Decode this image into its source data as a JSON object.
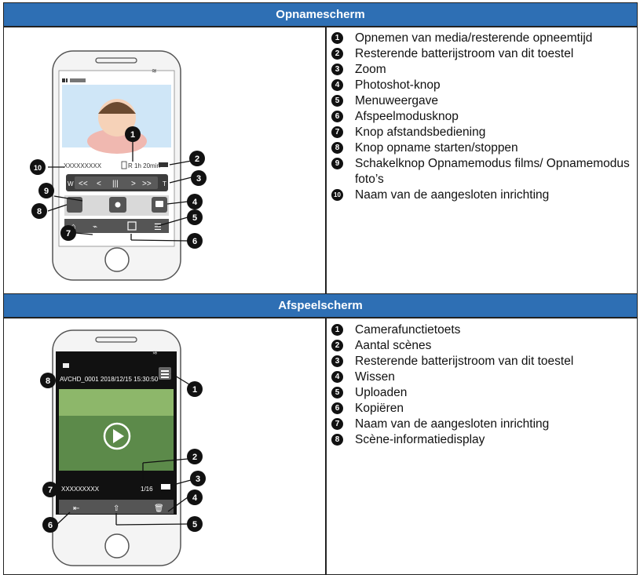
{
  "sections": [
    {
      "title": "Opnamescherm",
      "items": [
        {
          "num": "1",
          "text": "Opnemen van media/resterende opneemtijd"
        },
        {
          "num": "2",
          "text": "Resterende batterijstroom van dit toestel"
        },
        {
          "num": "3",
          "text": "Zoom"
        },
        {
          "num": "4",
          "text": "Photoshot-knop"
        },
        {
          "num": "5",
          "text": "Menuweergave"
        },
        {
          "num": "6",
          "text": "Afspeelmodusknop"
        },
        {
          "num": "7",
          "text": "Knop afstandsbediening"
        },
        {
          "num": "8",
          "text": "Knop opname starten/stoppen"
        },
        {
          "num": "9",
          "text": "Schakelknop Opnamemodus films/ Opnamemodus foto’s"
        },
        {
          "num": "10",
          "text": "Naam van de aangesloten inrichting"
        }
      ],
      "screen": {
        "device_name": "XXXXXXXXX",
        "remaining": "R 1h 20min",
        "zoom_buttons": [
          "W",
          "<<",
          "<",
          "|||",
          ">",
          ">>",
          "T"
        ]
      }
    },
    {
      "title": "Afspeelscherm",
      "items": [
        {
          "num": "1",
          "text": "Camerafunctietoets"
        },
        {
          "num": "2",
          "text": "Aantal scènes"
        },
        {
          "num": "3",
          "text": "Resterende batterijstroom van dit toestel"
        },
        {
          "num": "4",
          "text": "Wissen"
        },
        {
          "num": "5",
          "text": "Uploaden"
        },
        {
          "num": "6",
          "text": "Kopiëren"
        },
        {
          "num": "7",
          "text": "Naam van de aangesloten inrichting"
        },
        {
          "num": "8",
          "text": "Scène-informatiedisplay"
        }
      ],
      "screen": {
        "scene_info": "AVCHD_0001  2018/12/15 15:30:50",
        "scene_count": "1/16",
        "device_name": "XXXXXXXXX"
      }
    }
  ]
}
